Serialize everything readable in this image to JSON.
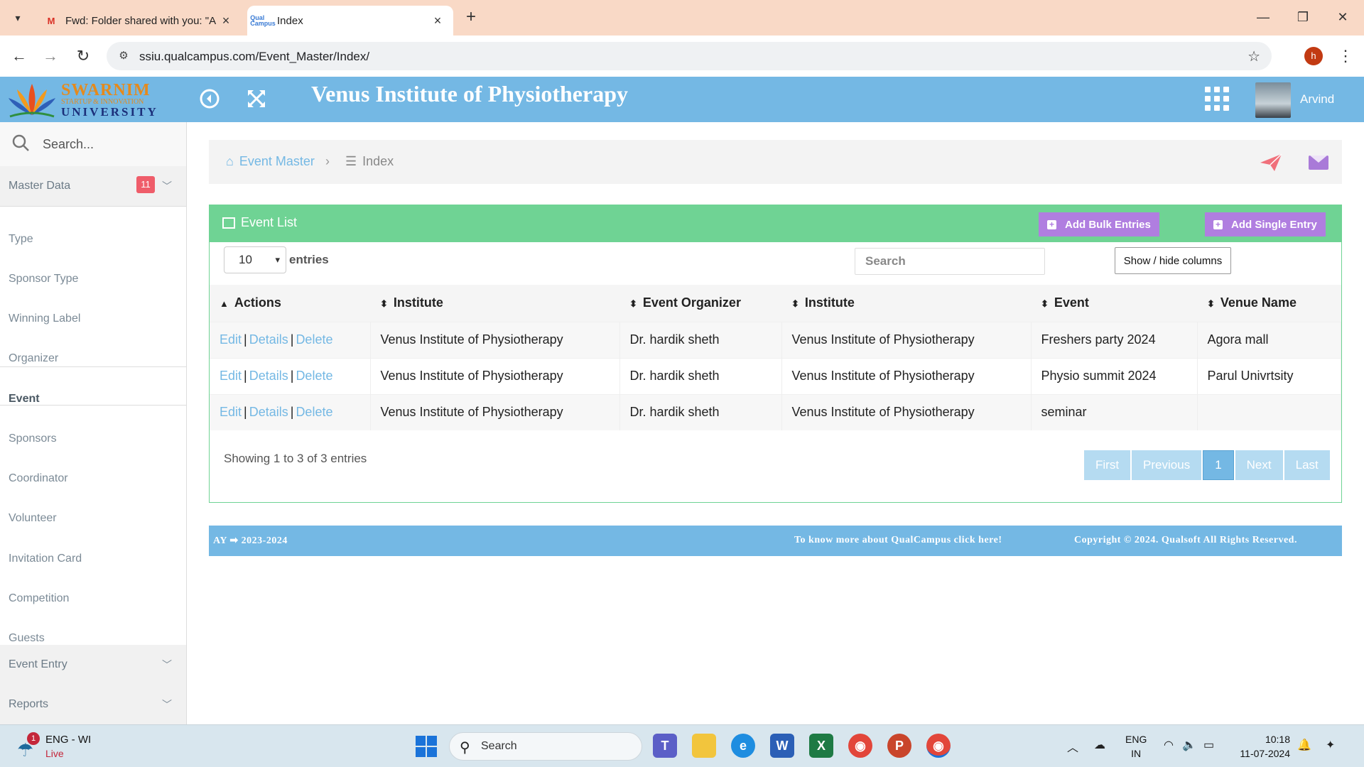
{
  "browser": {
    "tabs": [
      {
        "title": "Fwd: Folder shared with you: \"A",
        "favicon": "gmail-icon",
        "active": false
      },
      {
        "title": "Index",
        "favicon": "qualcampus-icon",
        "active": true
      }
    ],
    "url": "ssiu.qualcampus.com/Event_Master/Index/",
    "profile_initial": "h"
  },
  "header": {
    "logo": {
      "line1": "SWARNIM",
      "line2": "STARTUP & INNOVATION",
      "line3": "UNIVERSITY"
    },
    "title": "Venus Institute of Physiotherapy",
    "username": "Arvind"
  },
  "sidebar": {
    "search_placeholder": "Search...",
    "items": [
      {
        "label": "Master Data",
        "badge": "11",
        "type": "group"
      },
      {
        "label": "Type"
      },
      {
        "label": "Sponsor Type"
      },
      {
        "label": "Winning Label"
      },
      {
        "label": "Organizer"
      },
      {
        "label": "Event",
        "active": true
      },
      {
        "label": "Sponsors"
      },
      {
        "label": "Coordinator"
      },
      {
        "label": "Volunteer"
      },
      {
        "label": "Invitation Card"
      },
      {
        "label": "Competition"
      },
      {
        "label": "Guests"
      },
      {
        "label": "Event Entry",
        "type": "group"
      },
      {
        "label": "Reports",
        "type": "group"
      }
    ]
  },
  "breadcrumb": {
    "item1": "Event Master",
    "item2": "Index"
  },
  "panel": {
    "title": "Event List",
    "add_bulk": "Add Bulk Entries",
    "add_single": "Add Single Entry",
    "page_size": "10",
    "entries_label": "entries",
    "search_placeholder": "Search",
    "show_hide": "Show / hide columns"
  },
  "table": {
    "columns": [
      "Actions",
      "Institute",
      "Event Organizer",
      "Institute",
      "Event",
      "Venue Name"
    ],
    "action_labels": {
      "edit": "Edit",
      "details": "Details",
      "delete": "Delete",
      "sep": "|"
    },
    "rows": [
      {
        "institute": "Venus Institute of Physiotherapy",
        "organizer": "Dr. hardik sheth",
        "institute2": "Venus Institute of Physiotherapy",
        "event": "Freshers party 2024",
        "venue": "Agora mall"
      },
      {
        "institute": "Venus Institute of Physiotherapy",
        "organizer": "Dr. hardik sheth",
        "institute2": "Venus Institute of Physiotherapy",
        "event": "Physio summit 2024",
        "venue": "Parul Univrtsity"
      },
      {
        "institute": "Venus Institute of Physiotherapy",
        "organizer": "Dr. hardik sheth",
        "institute2": "Venus Institute of Physiotherapy",
        "event": "seminar",
        "venue": ""
      }
    ],
    "info": "Showing 1 to 3 of 3 entries",
    "pager": {
      "first": "First",
      "previous": "Previous",
      "current": "1",
      "next": "Next",
      "last": "Last"
    }
  },
  "footer": {
    "ay_label": "AY",
    "ay_value": "2023-2024",
    "more_link": "To know more about QualCampus click here!",
    "copyright": "Copyright © 2024. Qualsoft All Rights Reserved."
  },
  "taskbar": {
    "weather_badge": "1",
    "weather_line1": "ENG - WI",
    "weather_line2": "Live",
    "search_label": "Search",
    "lang_line1": "ENG",
    "lang_line2": "IN",
    "time": "10:18",
    "date": "11-07-2024"
  },
  "colors": {
    "brand_blue": "#74b8e4",
    "panel_green": "#6fd394",
    "button_purple": "#b07ee0",
    "badge_red": "#ef5d6a"
  }
}
